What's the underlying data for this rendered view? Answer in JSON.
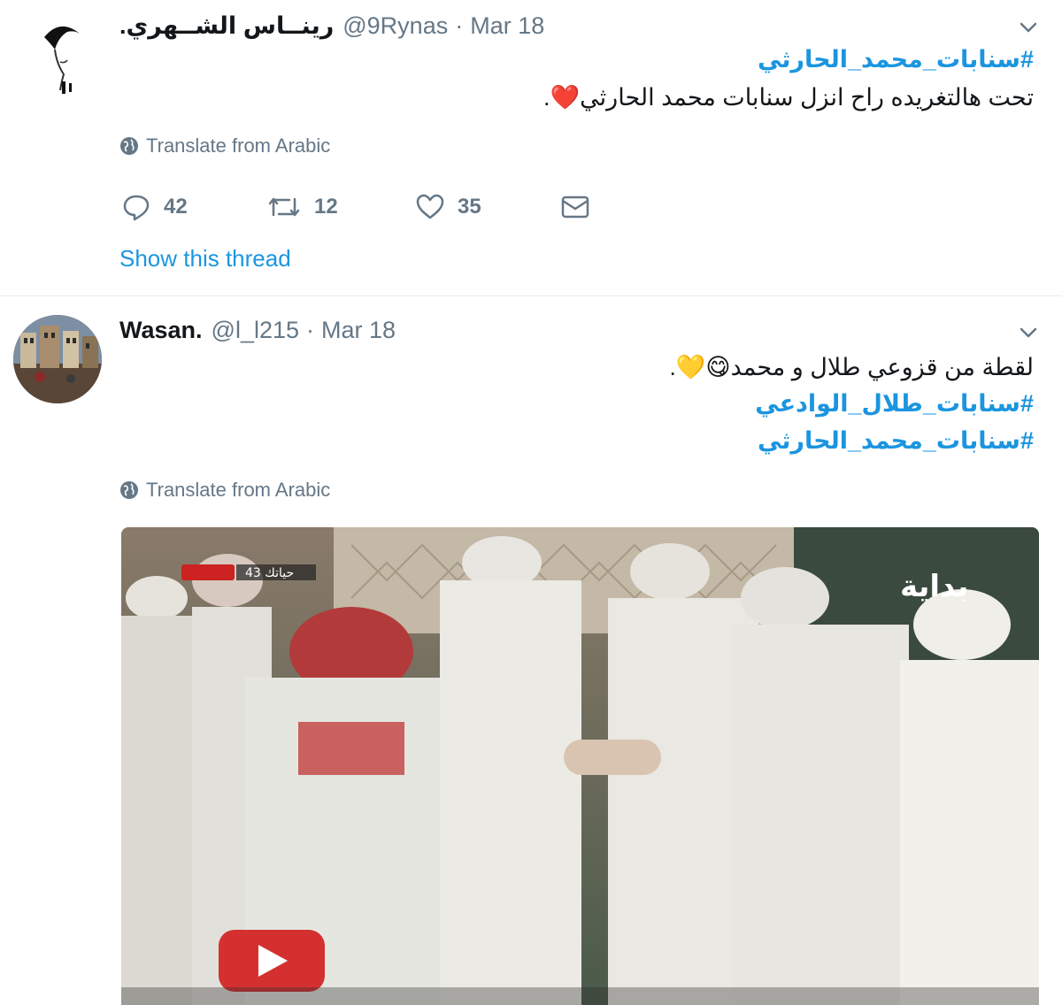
{
  "tweets": [
    {
      "name": "رينــاس الشــهري.",
      "handle": "@9Rynas",
      "date": "Mar 18",
      "hashtags": [
        "#سنابات_محمد_الحارثي"
      ],
      "text": "تحت هالتغريده راح انزل سنابات محمد الحارثي❤️.",
      "translate": "Translate from Arabic",
      "actions": {
        "reply": "42",
        "retweet": "12",
        "like": "35"
      },
      "show_thread": "Show this thread"
    },
    {
      "name": "Wasan.",
      "handle": "@l_l215",
      "date": "Mar 18",
      "text": "لقطة من قزوعي طلال و محمد😋💛.",
      "hashtags": [
        "#سنابات_طلال_الوادعي",
        "#سنابات_محمد_الحارثي"
      ],
      "translate": "Translate from Arabic",
      "media": {
        "type": "video",
        "overlay_text": "حياتك 43",
        "channel_logo": "بداية"
      }
    }
  ],
  "icons": {
    "reply": "reply-icon",
    "retweet": "retweet-icon",
    "like": "heart-icon",
    "dm": "envelope-icon",
    "globe": "globe-icon",
    "caret": "chevron-down-icon",
    "play": "play-icon"
  },
  "colors": {
    "link": "#1b95e0",
    "secondary": "#657786",
    "text": "#14171a",
    "divider": "#e6ecf0"
  }
}
